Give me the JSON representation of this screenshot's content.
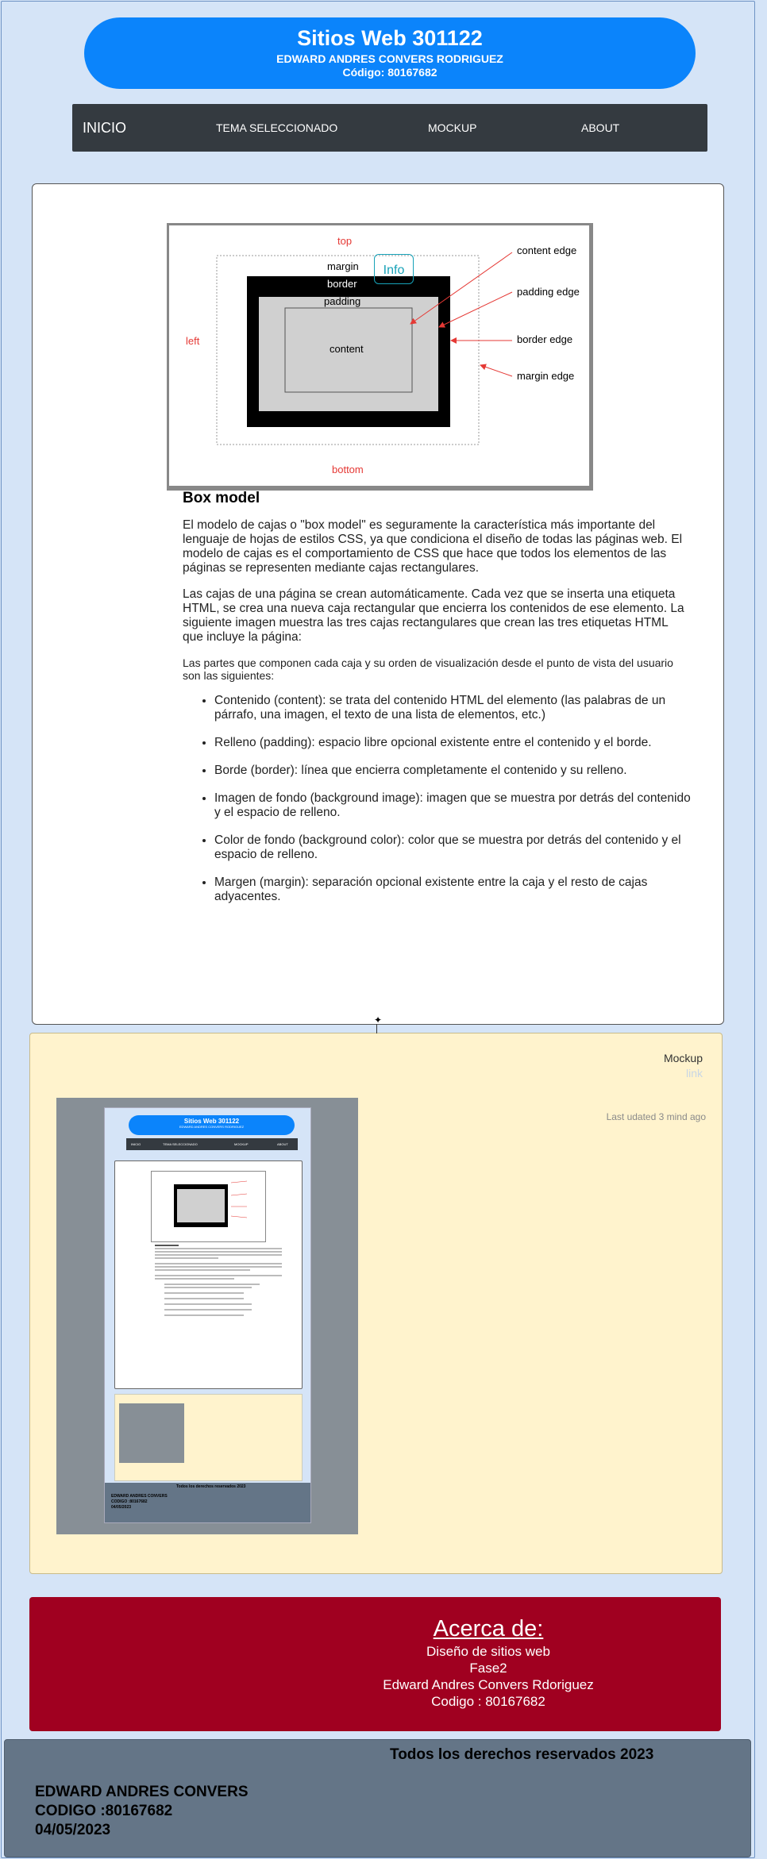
{
  "header": {
    "title": "Sitios Web 301122",
    "author": "EDWARD ANDRES CONVERS RODRIGUEZ",
    "code": "Código: 80167682"
  },
  "nav": {
    "brand": "INICIO",
    "items": [
      "TEMA SELECCIONADO",
      "MOCKUP",
      "ABOUT"
    ]
  },
  "figure": {
    "labels": {
      "top": "top",
      "bottom": "bottom",
      "left": "left",
      "margin": "margin",
      "border": "border",
      "padding": "padding",
      "content": "content",
      "content_edge": "content edge",
      "padding_edge": "padding edge",
      "border_edge": "border edge",
      "margin_edge": "margin edge"
    },
    "info_button": "Info"
  },
  "article": {
    "heading": "Box model",
    "p1": "El modelo de cajas o \"box model\" es seguramente la característica más importante del lenguaje de hojas de estilos CSS, ya que condiciona el diseño de todas las páginas web. El modelo de cajas es el comportamiento de CSS que hace que todos los elementos de las páginas se representen mediante cajas rectangulares.",
    "p2": "Las cajas de una página se crean automáticamente. Cada vez que se inserta una etiqueta HTML, se crea una nueva caja rectangular que encierra los contenidos de ese elemento. La siguiente imagen muestra las tres cajas rectangulares que crean las tres etiquetas HTML que incluye la página:",
    "p3": "Las partes que componen cada caja y su orden de visualización desde el punto de vista del usuario son las siguientes:",
    "items": [
      "Contenido (content): se trata del contenido HTML del elemento (las palabras de un párrafo, una imagen, el texto de una lista de elementos, etc.)",
      "Relleno (padding): espacio libre opcional existente entre el contenido y el borde.",
      "Borde (border): línea que encierra completamente el contenido y su relleno.",
      "Imagen de fondo (background image): imagen que se muestra por detrás del contenido y el espacio de relleno.",
      "Color de fondo (background color): color que se muestra por detrás del contenido y el espacio de relleno.",
      "Margen (margin): separación opcional existente entre la caja y el resto de cajas adyacentes."
    ]
  },
  "mockup": {
    "title": "Mockup",
    "link": "link",
    "updated": "Last udated 3 mind ago"
  },
  "about": {
    "title": "Acerca de:",
    "line1": "Diseño de sitios web",
    "line2": "Fase2",
    "line3": "Edward Andres Convers Rdoriguez",
    "line4": "Codigo : 80167682"
  },
  "footer": {
    "rights": "Todos los derechos reservados 2023",
    "name": "EDWARD ANDRES CONVERS",
    "code": "CODIGO :80167682",
    "date": "04/05/2023"
  },
  "colors": {
    "page_bg": "#d5e4f7",
    "header_blue": "#0b84fb",
    "nav_dark": "#343a40",
    "mockup_bg": "#fff3cd",
    "about_red": "#a00020",
    "footer_slate": "#647587",
    "info_teal": "#17a2b8",
    "label_red": "#e53935"
  }
}
